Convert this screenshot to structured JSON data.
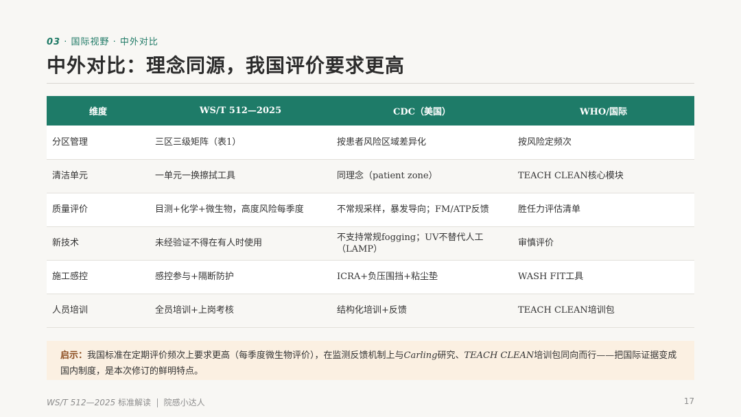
{
  "section": {
    "number": "03",
    "label": "· 国际视野 · 中外对比"
  },
  "title": "中外对比：理念同源，我国评价要求更高",
  "table": {
    "headers": [
      "维度",
      "WS/T 512—2025",
      "CDC（美国）",
      "WHO/国际"
    ],
    "rows": [
      [
        "分区管理",
        "三区三级矩阵（表1）",
        "按患者风险区域差异化",
        "按风险定频次"
      ],
      [
        "清洁单元",
        "一单元一换擦拭工具",
        "同理念（patient zone）",
        "TEACH CLEAN核心模块"
      ],
      [
        "质量评价",
        "目测+化学+微生物，高度风险每季度",
        "不常规采样，暴发导向；FM/ATP反馈",
        "胜任力评估清单"
      ],
      [
        "新技术",
        "未经验证不得在有人时使用",
        "不支持常规fogging；UV不替代人工（LAMP）",
        "审慎评价"
      ],
      [
        "施工感控",
        "感控参与+隔断防护",
        "ICRA+负压围挡+粘尘垫",
        "WASH FIT工具"
      ],
      [
        "人员培训",
        "全员培训+上岗考核",
        "结构化培训+反馈",
        "TEACH CLEAN培训包"
      ]
    ]
  },
  "callout": {
    "lead": "启示：",
    "text_a": "我国标准在定期评价频次上要求更高（每季度微生物评价），在监测反馈机制上与",
    "em_a": "Carling",
    "text_b": "研究、",
    "em_b": "TEACH CLEAN",
    "text_c": "培训包同向而行——把国际证据变成国内制度，是本次修订的鲜明特点。"
  },
  "footer": {
    "doc": "WS/T 512—2025",
    "doc_suffix": "标准解读",
    "author": "院感小达人"
  },
  "page_number": "17",
  "colors": {
    "accent": "#1e7b68",
    "callout_bg": "#fbf0e2",
    "callout_lead": "#8a4a1c"
  }
}
